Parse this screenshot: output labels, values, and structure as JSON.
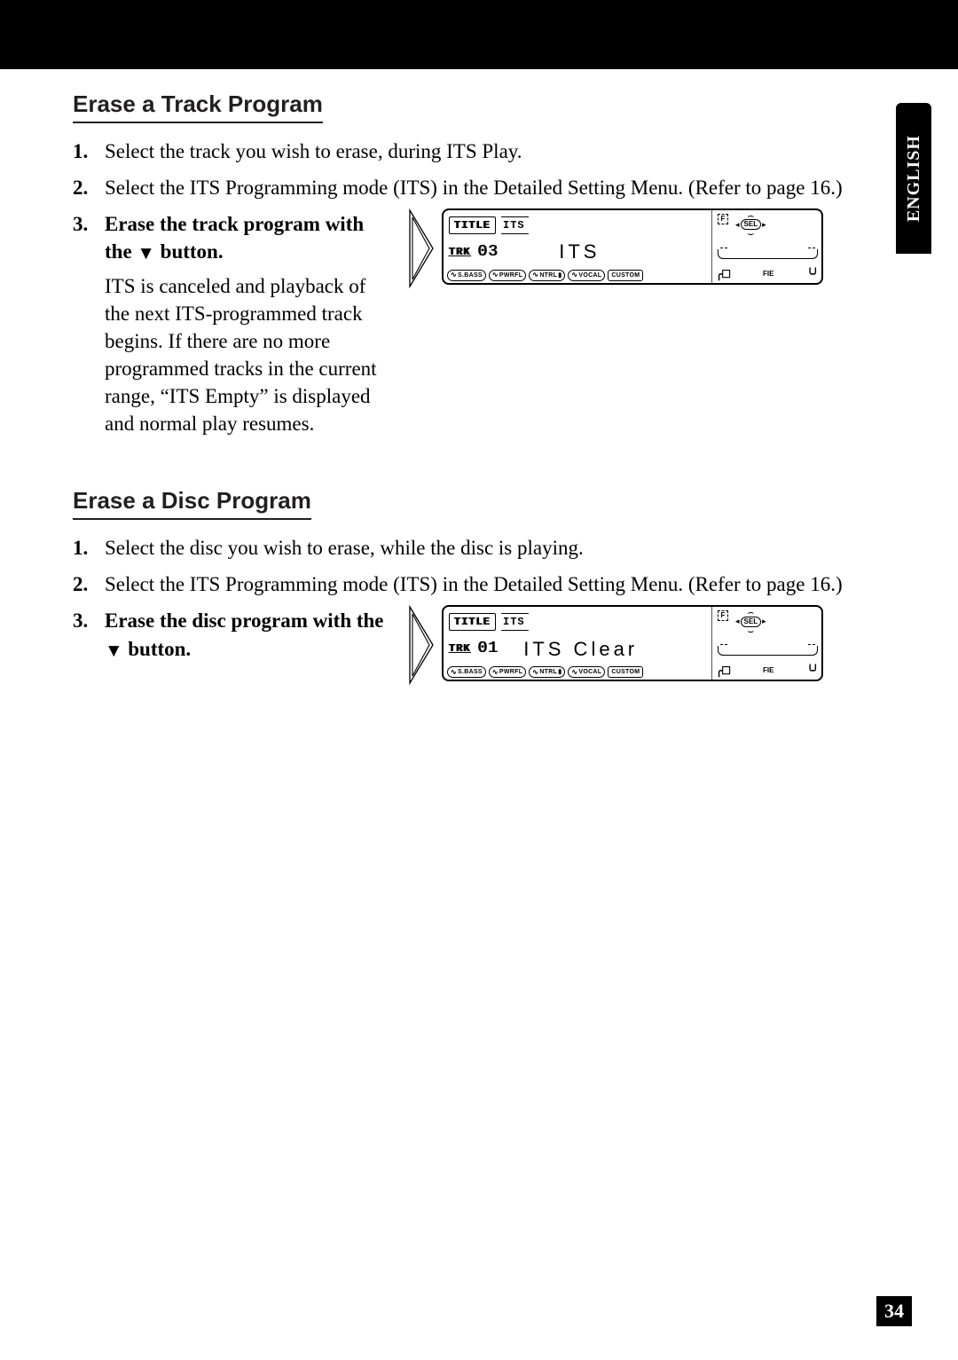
{
  "meta": {
    "language_tab": "ENGLISH",
    "page_number": "34"
  },
  "section1": {
    "title": "Erase a Track Program",
    "steps": {
      "s1": {
        "num": "1.",
        "bold": "Select the track you wish to erase, during ITS Play."
      },
      "s2": {
        "num": "2.",
        "bold": "Select the ITS Programming mode (ITS) in the Detailed Setting Menu. (Refer to page 16.)"
      },
      "s3": {
        "num": "3.",
        "bold_a": "Erase the track program with the ",
        "bold_b": " button.",
        "desc": "ITS is canceled and playback of the next ITS-programmed track begins. If there are no more programmed tracks in the current range, “ITS Empty” is displayed and normal play resumes."
      }
    },
    "display": {
      "title_ind": "TITLE",
      "its_ind": "ITS",
      "trk_label": "TRK",
      "trk_num": "03",
      "main_text": "ITS",
      "eq": {
        "sbass": "S.BASS",
        "pwrfl": "PWRFL",
        "ntrl": "NTRL",
        "vocal": "VOCAL",
        "custom": "CUSTOM"
      },
      "right": {
        "f": "F",
        "sel": "SEL",
        "fie": "FIE"
      }
    }
  },
  "section2": {
    "title": "Erase a Disc Program",
    "steps": {
      "s1": {
        "num": "1.",
        "bold": "Select the disc you wish to erase, while the disc is playing."
      },
      "s2": {
        "num": "2.",
        "bold": "Select the ITS Programming mode (ITS) in the Detailed Setting Menu. (Refer to page 16.)"
      },
      "s3": {
        "num": "3.",
        "bold_a": "Erase the disc program with the ",
        "bold_b": " button."
      }
    },
    "display": {
      "title_ind": "TITLE",
      "its_ind": "ITS",
      "trk_label": "TRK",
      "trk_num": "01",
      "main_text": "ITS Clear",
      "eq": {
        "sbass": "S.BASS",
        "pwrfl": "PWRFL",
        "ntrl": "NTRL",
        "vocal": "VOCAL",
        "custom": "CUSTOM"
      },
      "right": {
        "f": "F",
        "sel": "SEL",
        "fie": "FIE"
      }
    }
  }
}
